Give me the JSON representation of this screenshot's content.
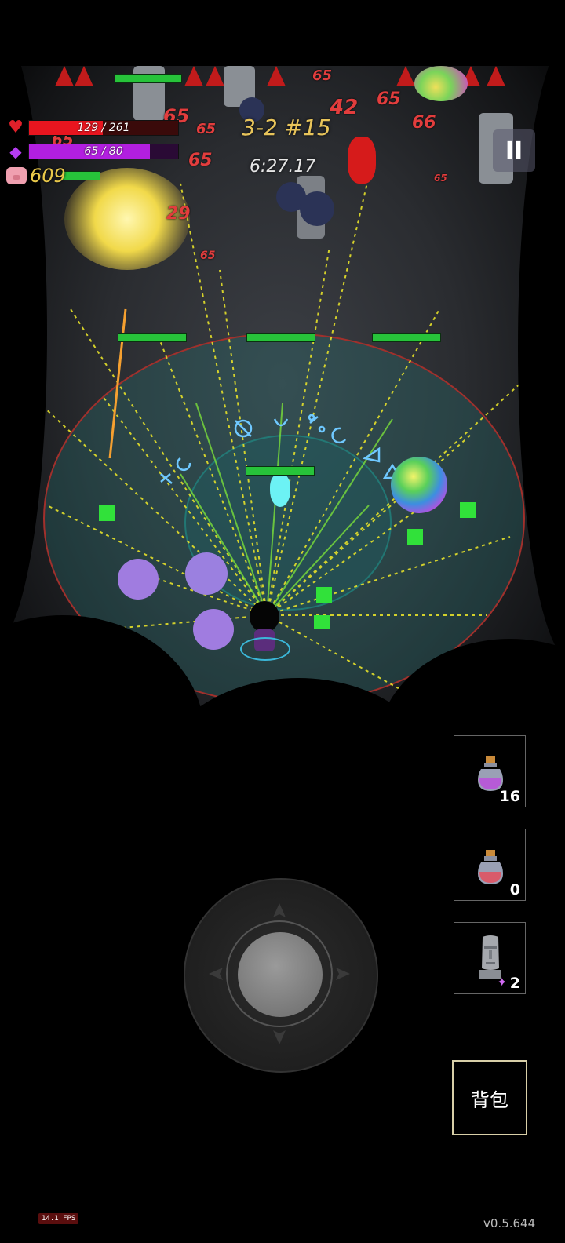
{
  "hud": {
    "hp_text": "129 / 261",
    "hp_fraction": 0.494,
    "mp_text": "65 / 80",
    "mp_fraction": 0.8125,
    "coins": "609",
    "stage": "3-2 #15",
    "timer": "6:27.17",
    "pause_label": "II"
  },
  "damage_numbers": [
    "65",
    "65",
    "65",
    "65",
    "65",
    "42",
    "66",
    "65",
    "29",
    "65",
    "65"
  ],
  "items": [
    {
      "name": "mana-potion",
      "count": "16",
      "color": "#b65bd6"
    },
    {
      "name": "health-potion",
      "count": "0",
      "color": "#d95b6b"
    },
    {
      "name": "moai-statue",
      "count": "2"
    }
  ],
  "bag_label": "背包",
  "fps_text": "14.1 FPS",
  "version": "v0.5.644",
  "colors": {
    "hp": "#e8151f",
    "mp": "#b21fe0",
    "coin": "#e9c84a",
    "stage": "#e8c45a",
    "enemy_hp": "#27c33a"
  }
}
